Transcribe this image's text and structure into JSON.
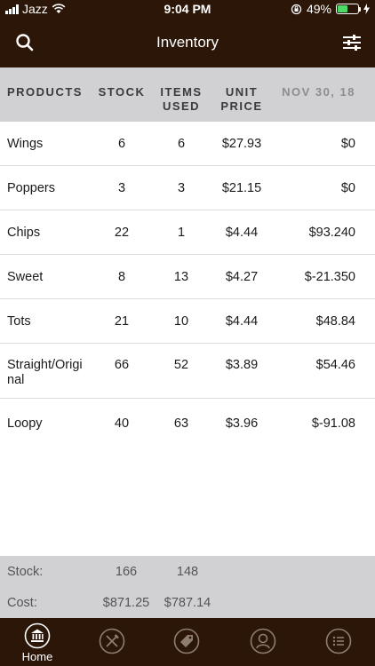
{
  "status_bar": {
    "carrier": "Jazz",
    "time": "9:04 PM",
    "battery": "49%",
    "battery_level": 0.49
  },
  "nav": {
    "title": "Inventory"
  },
  "table": {
    "headers": {
      "products": "PRODUCTS",
      "stock": "STOCK",
      "items_used_1": "ITEMS",
      "items_used_2": "USED",
      "unit_price_1": "UNIT",
      "unit_price_2": "PRICE",
      "date": "NOV 30, 18"
    },
    "rows": [
      {
        "product": "Wings",
        "stock": "6",
        "used": "6",
        "price": "$27.93",
        "value": "$0"
      },
      {
        "product": "Poppers",
        "stock": "3",
        "used": "3",
        "price": "$21.15",
        "value": "$0"
      },
      {
        "product": "Chips",
        "stock": "22",
        "used": "1",
        "price": "$4.44",
        "value": "$93.240"
      },
      {
        "product": "Sweet",
        "stock": "8",
        "used": "13",
        "price": "$4.27",
        "value": "$-21.350"
      },
      {
        "product": "Tots",
        "stock": "21",
        "used": "10",
        "price": "$4.44",
        "value": "$48.84"
      },
      {
        "product": "Straight/Origi",
        "product_line2": "nal",
        "stock": "66",
        "used": "52",
        "price": "$3.89",
        "value": "$54.46"
      },
      {
        "product": "Loopy",
        "stock": "40",
        "used": "63",
        "price": "$3.96",
        "value": "$-91.08"
      }
    ]
  },
  "totals": {
    "stock_label": "Stock:",
    "stock_total": "166",
    "stock_used": "148",
    "cost_label": "Cost:",
    "cost_total": "$871.25",
    "cost_used": "$787.14"
  },
  "tabbar": {
    "home_label": "Home"
  }
}
